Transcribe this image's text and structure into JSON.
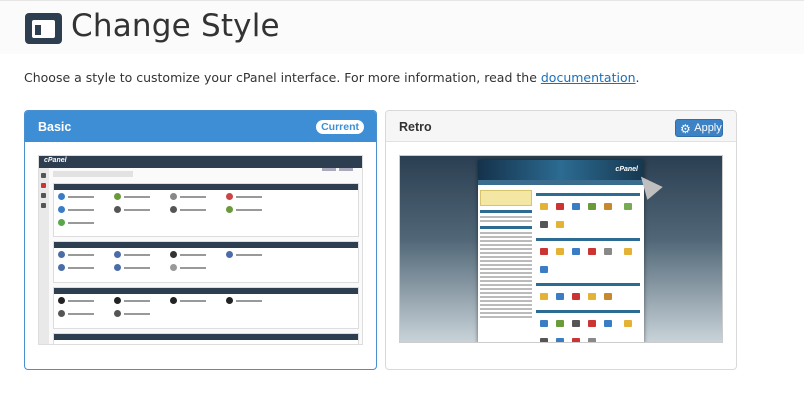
{
  "page": {
    "title": "Change Style",
    "description_text": "Choose a style to customize your cPanel interface. For more information, read the ",
    "description_link": "documentation",
    "description_end": "."
  },
  "styles": [
    {
      "name": "Basic",
      "badge": "Current",
      "selected": true
    },
    {
      "name": "Retro",
      "action": "Apply",
      "selected": false
    }
  ],
  "preview_basic": {
    "logo": "cPanel"
  },
  "preview_retro": {
    "logo": "cPanel"
  },
  "colors": {
    "accent": "#3e8ed6",
    "header_icon": "#2d3e50",
    "link": "#1a6fb8"
  },
  "icons": {
    "header": "window-layout-icon",
    "apply": "gear-icon"
  }
}
